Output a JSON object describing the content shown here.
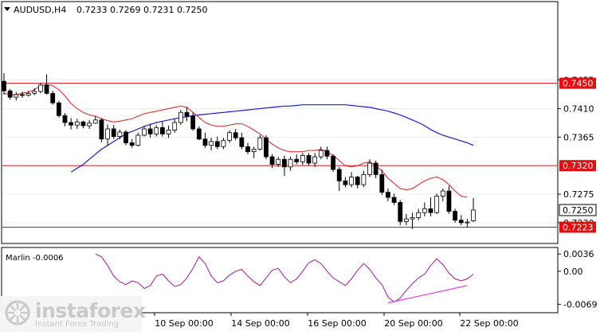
{
  "window": {
    "symbol": "AUDUSD,H4",
    "ohlc": "0.7233 0.7269 0.7231 0.7250"
  },
  "colors": {
    "bull": "#ffffff",
    "bear": "#000000",
    "envelope": "#d92020",
    "ma": "#1c1cd6",
    "level_line": "#e01010",
    "marlin": "#9b1b9b",
    "divergence": "#e048e0",
    "price_tag_bg": "#e01010",
    "current_tag_bg": "#ffffff"
  },
  "price_axis": {
    "ticks": [
      "0.7455",
      "0.7410",
      "0.7365",
      "0.7275",
      "0.7230"
    ],
    "range": [
      0.71985,
      0.75775
    ]
  },
  "levels": [
    {
      "value": 0.745,
      "label": "0.7450"
    },
    {
      "value": 0.732,
      "label": "0.7320"
    },
    {
      "value": 0.7223,
      "label": "0.7223"
    }
  ],
  "current_price": {
    "value": 0.725,
    "label": "0.7250"
  },
  "marlin": {
    "label": "Marlin -0.0006",
    "ticks": [
      "0.0036",
      "0.00",
      "-0.0069"
    ],
    "range": [
      -0.0085,
      0.0048
    ]
  },
  "time_axis": [
    "10 Sep 00:00",
    "14 Sep 00:00",
    "16 Sep 00:00",
    "20 Sep 00:00",
    "22 Sep 00:00"
  ],
  "watermark": {
    "name": "instaforex",
    "sub": "Instant Forex Trading"
  },
  "chart_data": {
    "type": "candlestick",
    "series": [
      {
        "name": "AUDUSD,H4",
        "ohlc": [
          [
            0.7453,
            0.7466,
            0.7432,
            0.7438
          ],
          [
            0.7438,
            0.7441,
            0.7424,
            0.7428
          ],
          [
            0.7428,
            0.7436,
            0.7423,
            0.7432
          ],
          [
            0.7432,
            0.7437,
            0.7427,
            0.7431
          ],
          [
            0.7431,
            0.7438,
            0.7429,
            0.7434
          ],
          [
            0.7434,
            0.7442,
            0.7431,
            0.7437
          ],
          [
            0.7437,
            0.7451,
            0.7434,
            0.7447
          ],
          [
            0.7447,
            0.7464,
            0.7432,
            0.7434
          ],
          [
            0.7434,
            0.7438,
            0.7416,
            0.7419
          ],
          [
            0.7419,
            0.7422,
            0.7396,
            0.7399
          ],
          [
            0.7399,
            0.7403,
            0.7382,
            0.7388
          ],
          [
            0.7388,
            0.7395,
            0.7377,
            0.7384
          ],
          [
            0.7384,
            0.7394,
            0.7378,
            0.7389
          ],
          [
            0.7389,
            0.7391,
            0.7379,
            0.7383
          ],
          [
            0.7383,
            0.7392,
            0.7378,
            0.7387
          ],
          [
            0.7387,
            0.7398,
            0.7386,
            0.7392
          ],
          [
            0.7392,
            0.7395,
            0.7357,
            0.7362
          ],
          [
            0.7362,
            0.7385,
            0.7352,
            0.7378
          ],
          [
            0.7378,
            0.7384,
            0.7362,
            0.7366
          ],
          [
            0.7366,
            0.7377,
            0.7362,
            0.7373
          ],
          [
            0.7373,
            0.7376,
            0.7352,
            0.7356
          ],
          [
            0.7356,
            0.7362,
            0.7348,
            0.7352
          ],
          [
            0.7352,
            0.7372,
            0.735,
            0.7368
          ],
          [
            0.7368,
            0.7382,
            0.7366,
            0.7378
          ],
          [
            0.7378,
            0.7386,
            0.7364,
            0.737
          ],
          [
            0.737,
            0.7384,
            0.7366,
            0.738
          ],
          [
            0.738,
            0.739,
            0.7366,
            0.737
          ],
          [
            0.737,
            0.7383,
            0.7364,
            0.7376
          ],
          [
            0.7376,
            0.7394,
            0.7372,
            0.7388
          ],
          [
            0.7388,
            0.7408,
            0.7384,
            0.7404
          ],
          [
            0.7404,
            0.7412,
            0.739,
            0.7398
          ],
          [
            0.7398,
            0.7404,
            0.7375,
            0.7378
          ],
          [
            0.7378,
            0.7382,
            0.736,
            0.7362
          ],
          [
            0.7362,
            0.7372,
            0.7348,
            0.7352
          ],
          [
            0.7352,
            0.7364,
            0.7344,
            0.7358
          ],
          [
            0.7358,
            0.7366,
            0.7346,
            0.735
          ],
          [
            0.735,
            0.7364,
            0.7346,
            0.736
          ],
          [
            0.736,
            0.7376,
            0.7356,
            0.7372
          ],
          [
            0.7372,
            0.7378,
            0.736,
            0.7364
          ],
          [
            0.7364,
            0.7372,
            0.7346,
            0.735
          ],
          [
            0.735,
            0.7356,
            0.7338,
            0.7342
          ],
          [
            0.7342,
            0.735,
            0.7332,
            0.7346
          ],
          [
            0.7346,
            0.7368,
            0.7344,
            0.7364
          ],
          [
            0.7364,
            0.7368,
            0.733,
            0.7334
          ],
          [
            0.7334,
            0.7338,
            0.7316,
            0.7322
          ],
          [
            0.7322,
            0.7334,
            0.7318,
            0.733
          ],
          [
            0.733,
            0.7336,
            0.7304,
            0.7318
          ],
          [
            0.7318,
            0.7334,
            0.7312,
            0.733
          ],
          [
            0.733,
            0.7338,
            0.7322,
            0.7326
          ],
          [
            0.7326,
            0.734,
            0.7321,
            0.7336
          ],
          [
            0.7336,
            0.734,
            0.732,
            0.7324
          ],
          [
            0.7324,
            0.734,
            0.7318,
            0.7334
          ],
          [
            0.7334,
            0.735,
            0.733,
            0.7344
          ],
          [
            0.7344,
            0.735,
            0.733,
            0.7335
          ],
          [
            0.7335,
            0.7338,
            0.731,
            0.7314
          ],
          [
            0.7314,
            0.7318,
            0.728,
            0.7296
          ],
          [
            0.7296,
            0.7302,
            0.7286,
            0.729
          ],
          [
            0.729,
            0.731,
            0.7286,
            0.7302
          ],
          [
            0.7302,
            0.7304,
            0.7284,
            0.729
          ],
          [
            0.729,
            0.7312,
            0.7286,
            0.7306
          ],
          [
            0.7306,
            0.733,
            0.7302,
            0.7324
          ],
          [
            0.7324,
            0.7328,
            0.73,
            0.7306
          ],
          [
            0.7306,
            0.7314,
            0.7274,
            0.7278
          ],
          [
            0.7278,
            0.7284,
            0.7264,
            0.727
          ],
          [
            0.727,
            0.7276,
            0.7258,
            0.7262
          ],
          [
            0.7262,
            0.7266,
            0.7226,
            0.7232
          ],
          [
            0.7232,
            0.7244,
            0.7226,
            0.7236
          ],
          [
            0.7236,
            0.7246,
            0.722,
            0.7238
          ],
          [
            0.7238,
            0.7252,
            0.7234,
            0.7246
          ],
          [
            0.7246,
            0.7262,
            0.724,
            0.7252
          ],
          [
            0.7252,
            0.727,
            0.724,
            0.7246
          ],
          [
            0.7246,
            0.7276,
            0.7244,
            0.7272
          ],
          [
            0.7272,
            0.7284,
            0.7264,
            0.728
          ],
          [
            0.728,
            0.7288,
            0.7244,
            0.7248
          ],
          [
            0.7248,
            0.7252,
            0.723,
            0.7234
          ],
          [
            0.7234,
            0.7242,
            0.7226,
            0.723
          ],
          [
            0.723,
            0.7236,
            0.7222,
            0.7231
          ],
          [
            0.7233,
            0.7269,
            0.7231,
            0.725
          ]
        ]
      },
      {
        "name": "Envelope",
        "values": [
          0.7434,
          0.7432,
          0.7432,
          0.7434,
          0.7436,
          0.744,
          0.7446,
          0.7448,
          0.7446,
          0.744,
          0.743,
          0.7418,
          0.741,
          0.7404,
          0.74,
          0.7398,
          0.7394,
          0.7391,
          0.7389,
          0.739,
          0.7392,
          0.7394,
          0.7398,
          0.7402,
          0.7404,
          0.7406,
          0.7408,
          0.741,
          0.7412,
          0.7414,
          0.7412,
          0.7404,
          0.7396,
          0.7388,
          0.7384,
          0.7382,
          0.7382,
          0.7384,
          0.7386,
          0.7386,
          0.7382,
          0.7376,
          0.737,
          0.7362,
          0.7354,
          0.7348,
          0.7344,
          0.7342,
          0.7342,
          0.7342,
          0.7344,
          0.7344,
          0.7346,
          0.7342,
          0.7336,
          0.7328,
          0.732,
          0.7318,
          0.732,
          0.7324,
          0.7326,
          0.732,
          0.7312,
          0.73,
          0.7292,
          0.7284,
          0.7282,
          0.7284,
          0.729,
          0.7296,
          0.73,
          0.7302,
          0.7298,
          0.729,
          0.728,
          0.7272,
          0.727
        ]
      },
      {
        "name": "MA",
        "values": [
          0.731,
          0.7316,
          0.7322,
          0.733,
          0.7338,
          0.7346,
          0.7352,
          0.7358,
          0.7364,
          0.737,
          0.7374,
          0.7378,
          0.7382,
          0.7385,
          0.7388,
          0.739,
          0.7392,
          0.7394,
          0.7396,
          0.7397,
          0.7399,
          0.74,
          0.7401,
          0.7402,
          0.7403,
          0.7404,
          0.7405,
          0.7406,
          0.7407,
          0.7408,
          0.7409,
          0.741,
          0.7411,
          0.7412,
          0.7413,
          0.7414,
          0.7414,
          0.7415,
          0.7416,
          0.7416,
          0.7416,
          0.7416,
          0.7416,
          0.7416,
          0.7416,
          0.7416,
          0.7415,
          0.7414,
          0.7413,
          0.7412,
          0.741,
          0.7408,
          0.7406,
          0.7403,
          0.74,
          0.7396,
          0.7392,
          0.7388,
          0.7383,
          0.7377,
          0.7372,
          0.7368,
          0.7365,
          0.7362,
          0.7359,
          0.7356,
          0.7352
        ]
      },
      {
        "name": "Marlin",
        "values": [
          0.0036,
          0.003,
          0.0012,
          -0.001,
          -0.0022,
          -0.0028,
          -0.002,
          -0.0024,
          -0.0036,
          -0.003,
          -0.001,
          -0.0006,
          -0.002,
          -0.0032,
          -0.0028,
          -0.0014,
          0.0006,
          0.003,
          0.0016,
          -0.001,
          -0.0024,
          -0.002,
          -0.0008,
          0.0,
          0.0004,
          -0.001,
          -0.0022,
          -0.003,
          -0.0014,
          0.0002,
          0.0006,
          -0.0012,
          -0.0024,
          -0.0016,
          0.0,
          0.0018,
          0.0024,
          0.0016,
          0.0,
          -0.0014,
          -0.0022,
          -0.003,
          -0.0016,
          0.0002,
          0.0016,
          0.0004,
          -0.0014,
          -0.0028,
          -0.0054,
          -0.0064,
          -0.0056,
          -0.004,
          -0.0026,
          -0.0014,
          -0.0006,
          0.0012,
          0.0026,
          0.0014,
          -0.0004,
          -0.0016,
          -0.002,
          -0.0016,
          -0.0006
        ]
      },
      {
        "name": "Divergence",
        "x": [
          63,
          76
        ],
        "values": [
          -0.0066,
          -0.003
        ]
      }
    ]
  }
}
